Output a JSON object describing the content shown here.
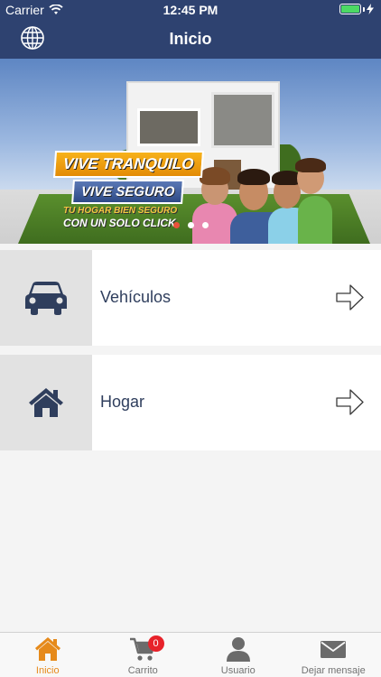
{
  "status_bar": {
    "carrier": "Carrier",
    "time": "12:45 PM"
  },
  "nav": {
    "title": "Inicio",
    "left_icon": "globe-icon"
  },
  "banner": {
    "line1": "VIVE TRANQUILO",
    "line2": "VIVE SEGURO",
    "line3": "TU HOGAR BIEN SEGURO",
    "line4": "CON UN SOLO CLICK",
    "pages": 3,
    "current_page": 1
  },
  "categories": [
    {
      "label": "Vehículos",
      "icon": "car-icon",
      "action_icon": "arrow-right-icon"
    },
    {
      "label": "Hogar",
      "icon": "house-icon",
      "action_icon": "arrow-right-icon"
    }
  ],
  "tabbar": {
    "items": [
      {
        "label": "Inicio",
        "icon": "home-icon",
        "active": true
      },
      {
        "label": "Carrito",
        "icon": "cart-icon",
        "badge": "0"
      },
      {
        "label": "Usuario",
        "icon": "user-icon"
      },
      {
        "label": "Dejar mensaje",
        "icon": "mail-icon"
      }
    ]
  },
  "colors": {
    "nav_background": "#2e4270",
    "accent": "#e68a1b",
    "icon_navy": "#2f3e5d",
    "badge": "#e7222a"
  }
}
